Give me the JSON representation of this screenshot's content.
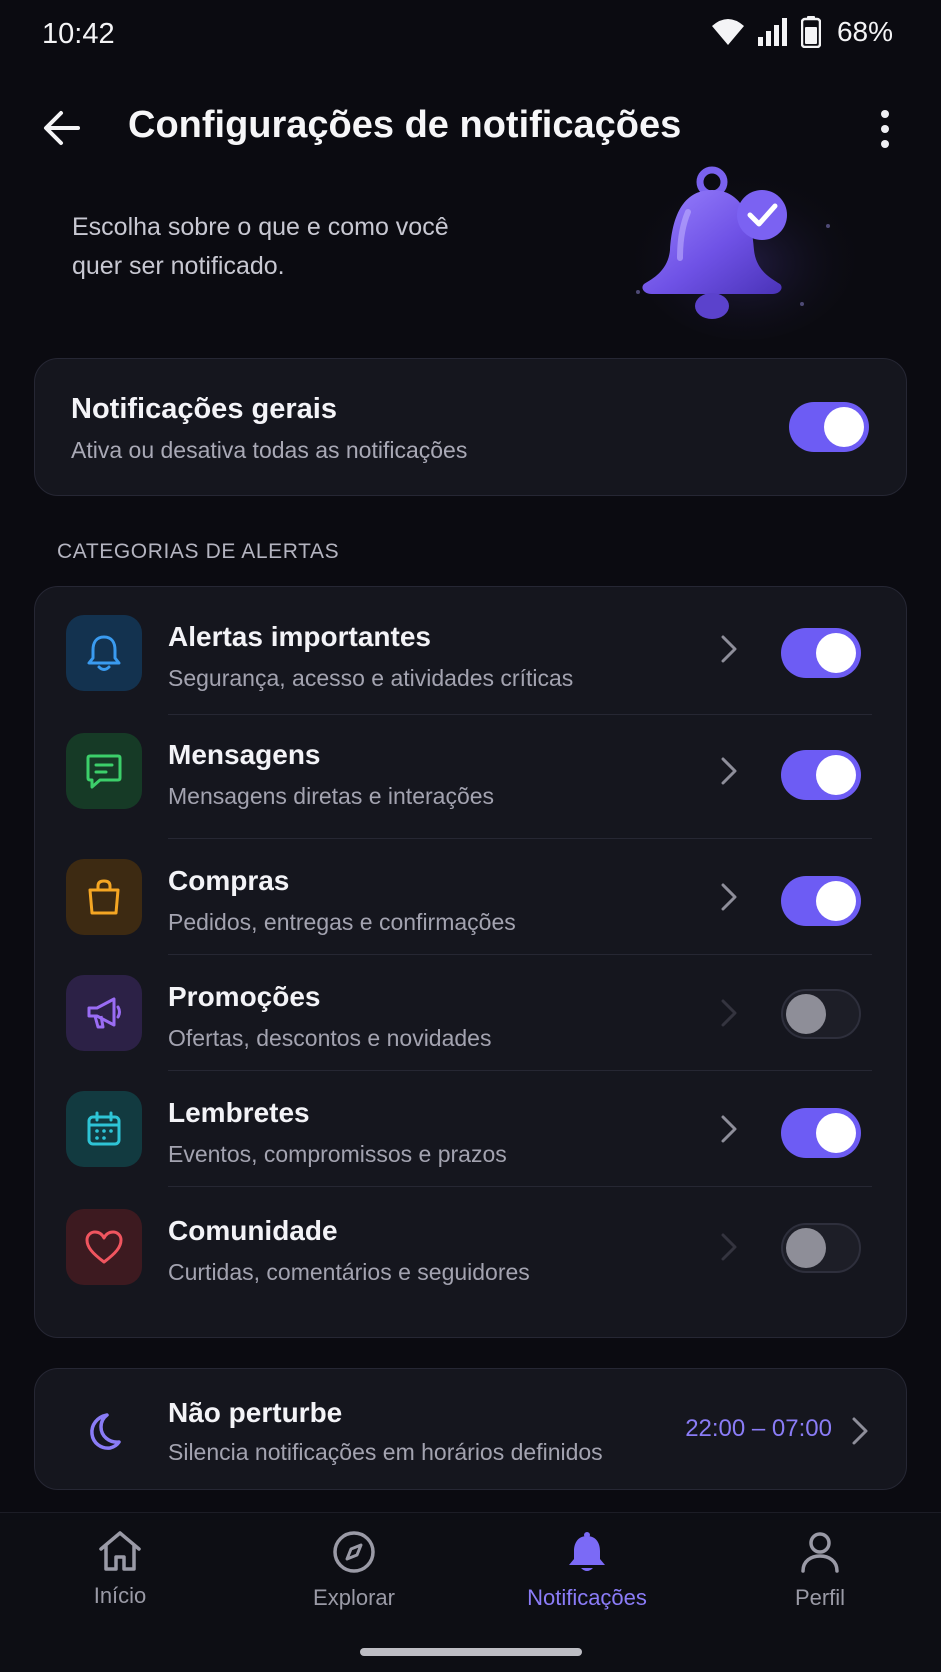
{
  "status_bar": {
    "time": "10:42",
    "battery": "68%"
  },
  "header": {
    "title": "Configurações de notificações"
  },
  "intro": {
    "text": "Escolha sobre o que e como você quer ser notificado."
  },
  "general": {
    "title": "Notificações gerais",
    "subtitle": "Ativa ou desativa todas as notificações",
    "enabled": true
  },
  "section_label": "CATEGORIAS DE ALERTAS",
  "categories": [
    {
      "title": "Alertas importantes",
      "subtitle": "Segurança, acesso e atividades críticas",
      "enabled": true,
      "icon": "bell-icon",
      "color": "#3a9bf0"
    },
    {
      "title": "Mensagens",
      "subtitle": "Mensagens diretas e interações",
      "enabled": true,
      "icon": "message-icon",
      "color": "#3ccf6a"
    },
    {
      "title": "Compras",
      "subtitle": "Pedidos, entregas e confirmações",
      "enabled": true,
      "icon": "shopping-bag-icon",
      "color": "#f5a623"
    },
    {
      "title": "Promoções",
      "subtitle": "Ofertas, descontos e novidades",
      "enabled": false,
      "icon": "megaphone-icon",
      "color": "#9a6cf4"
    },
    {
      "title": "Lembretes",
      "subtitle": "Eventos, compromissos e prazos",
      "enabled": true,
      "icon": "calendar-icon",
      "color": "#2ec4d6"
    },
    {
      "title": "Comunidade",
      "subtitle": "Curtidas, comentários e seguidores",
      "enabled": false,
      "icon": "heart-icon",
      "color": "#f0555f"
    }
  ],
  "dnd": {
    "title": "Não perturbe",
    "subtitle": "Silencia notificações em horários definidos",
    "time_range": "22:00 – 07:00"
  },
  "nav": [
    {
      "label": "Início",
      "icon": "home-icon",
      "active": false
    },
    {
      "label": "Explorar",
      "icon": "compass-icon",
      "active": false
    },
    {
      "label": "Notificações",
      "icon": "bell-icon",
      "active": true
    },
    {
      "label": "Perfil",
      "icon": "profile-icon",
      "active": false
    }
  ],
  "colors": {
    "accent": "#6d5cf4",
    "background": "#0b0b11",
    "card": "#15161e"
  }
}
